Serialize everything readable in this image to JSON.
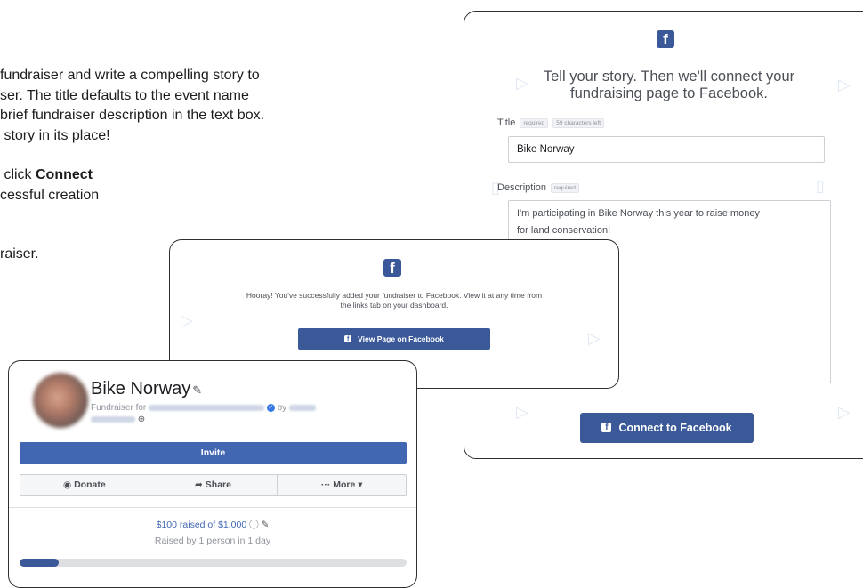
{
  "instructions": {
    "line1": "fundraiser and write a compelling story to",
    "line2": "ser. The title defaults to the event name",
    "line3": "brief fundraiser description in the text box.",
    "line4": " story in its place!",
    "line5_pre": " click ",
    "line5_bold": "Connect",
    "line6": "cessful creation",
    "line7": "raiser."
  },
  "story_card": {
    "fb_icon": "facebook-f-icon",
    "headline_1": "Tell your story. Then we'll connect your",
    "headline_2": "fundraising page to Facebook.",
    "title_label": "Title",
    "title_required": "required",
    "title_chars_left": "59 characters left",
    "title_value": "Bike Norway",
    "description_label": "Description",
    "description_required": "required",
    "description_line1": "I'm participating in Bike Norway this year to raise money",
    "description_line2": "for land conservation!",
    "connect_button": "Connect to Facebook"
  },
  "success_card": {
    "fb_icon": "facebook-f-icon",
    "message_line1": "Hooray! You've successfully added your fundraiser to Facebook. View it at any time from",
    "message_line2": "the links tab on your dashboard.",
    "view_button": "View Page on Facebook"
  },
  "fundraiser_card": {
    "title": "Bike Norway",
    "subtitle_prefix": "Fundraiser for",
    "subtitle_by": "by",
    "invite_button": "Invite",
    "donate": "Donate",
    "share": "Share",
    "more": "··· More ▾",
    "raised_text": "$100 raised of $1,000",
    "raised_by": "Raised by 1 person in 1 day",
    "progress_fraction": 0.1,
    "accent": "#3b5998"
  }
}
